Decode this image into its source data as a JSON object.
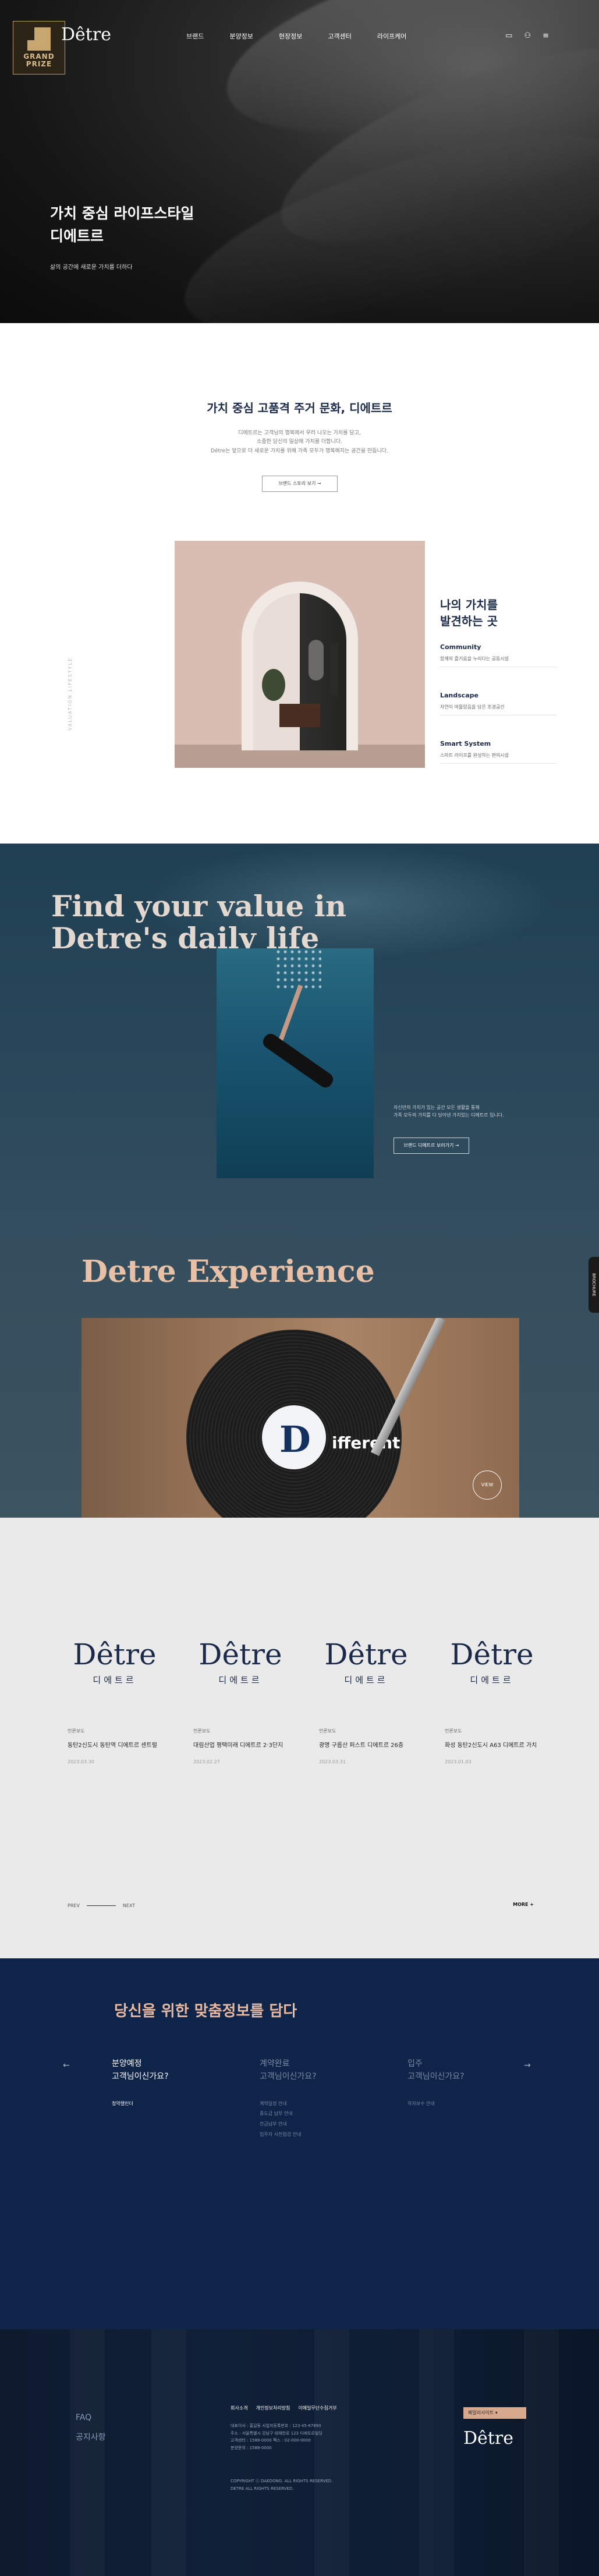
{
  "header": {
    "badge_text": "GRAND\nPRIZE",
    "logo": "Dêtre",
    "nav": [
      "브랜드",
      "분양정보",
      "현장정보",
      "고객센터",
      "라이프케어"
    ],
    "icons": [
      "calendar-icon",
      "user-icon",
      "menu-icon"
    ]
  },
  "hero": {
    "title": "가치 중심 라이프스타일\n디에트르",
    "subtitle": "삶의 공간에 새로운 가치를 더하다"
  },
  "intro": {
    "title": "가치 중심 고품격 주거 문화, 디에트르",
    "desc": [
      "디에트르는 고객님의 행복에서 우러 나오는 가치를 담고,",
      "소중한 당신의 일상에 가치를 더합니다.",
      "Dêtre는 앞으로 더 새로운 가치를 위해 가족 모두가 행복해지는 공간을 만듭니다."
    ],
    "button": "브랜드 스토리 보기 →",
    "vertical_label": "VALUATION LIFESTYLE",
    "side_title": "나의 가치를\n발견하는 곳",
    "items": [
      {
        "title": "Community",
        "desc": "함께의 즐거움을 누리다는 공동시설"
      },
      {
        "title": "Landscape",
        "desc": "자연이 머물렀음을 담은 조경공간"
      },
      {
        "title": "Smart System",
        "desc": "스마트 라이프를 완성하는 편의시설"
      }
    ]
  },
  "value": {
    "headline": "Find your value in\nDetre's daily life",
    "desc": "자신만의 가치가 있는 공간 모든 생활을 통해\n가족 모두의 가치를 다 담아낸 가치있는 디에트르 입니다.",
    "button": "브랜드 디에트르 보러가기 →",
    "experience_title": "Detre Experience",
    "vinyl_text": "ifferent",
    "vinyl_logo": "D",
    "view_button": "VIEW",
    "side_tab": "BROCHURE"
  },
  "news": {
    "cards": [
      {
        "logo": "Dêtre",
        "logo_ko": "디에트르",
        "category": "언론보도",
        "title": "동탄2신도시 동탄역 디에트르 센트럴",
        "date": "2023.03.30"
      },
      {
        "logo": "Dêtre",
        "logo_ko": "디에트르",
        "category": "언론보도",
        "title": "대림산업 평택미래 디에트르 2·3단지",
        "date": "2023.02.27"
      },
      {
        "logo": "Dêtre",
        "logo_ko": "디에트르",
        "category": "언론보도",
        "title": "광명 구름산 퍼스트 디에트르 26층",
        "date": "2023.03.31"
      },
      {
        "logo": "Dêtre",
        "logo_ko": "디에트르",
        "category": "언론보도",
        "title": "화성 동탄2신도시 A63 디에트르 가치",
        "date": "2023.01.03"
      }
    ],
    "pager_prev": "PREV",
    "pager_next": "NEXT",
    "more": "MORE +"
  },
  "info": {
    "title": "당신을 위한 맞춤정보를 담다",
    "prev_arrow": "←",
    "next_arrow": "→",
    "columns": [
      {
        "heading": "분양예정\n고객님이신가요?",
        "list": [
          "청약캘린더"
        ]
      },
      {
        "heading": "계약완료\n고객님이신가요?",
        "list": [
          "계약일정 안내",
          "중도금 납부 안내",
          "잔금납부 안내",
          "입주자 사전점검 안내"
        ]
      },
      {
        "heading": "입주\n고객님이신가요?",
        "list": [
          "하자보수 안내"
        ]
      }
    ]
  },
  "footer": {
    "links": [
      "FAQ",
      "공지사항"
    ],
    "nav": [
      "회사소개",
      "개인정보처리방침",
      "이메일무단수집거부"
    ],
    "info": "대표이사 : 홍길동  사업자등록번호 : 123-45-67890\n주소 : 서울특별시 강남구 테헤란로 123 디에트르빌딩\n고객센터 : 1588-0000   팩스 : 02-000-0000\n분양문의 : 1588-0000",
    "copyright": "COPYRIGHT ⓒ DAEDONG. ALL RIGHTS RESERVED.\nDETRE ALL RIGHTS RESERVED.",
    "family_select": "패밀리사이트  ▾",
    "logo": "Dêtre"
  }
}
